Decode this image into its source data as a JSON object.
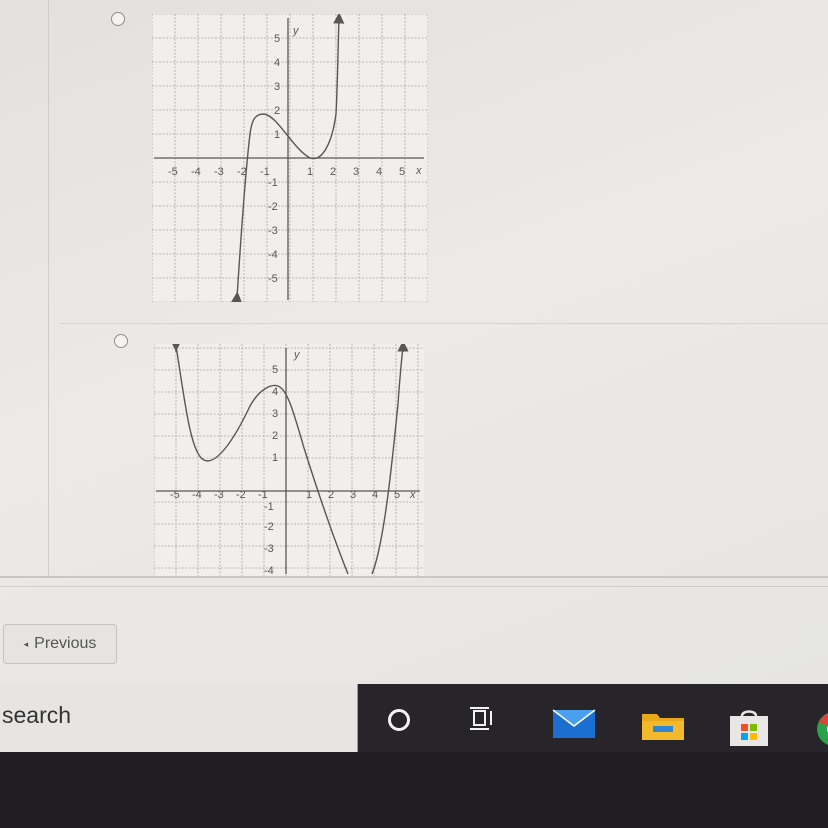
{
  "options": [
    {
      "graph": {
        "x_label": "x",
        "y_label": "y",
        "x_ticks": [
          "-5",
          "-4",
          "-3",
          "-2",
          "-1",
          "1",
          "2",
          "3",
          "4",
          "5"
        ],
        "y_ticks": [
          "5",
          "4",
          "3",
          "2",
          "1",
          "-1",
          "-2",
          "-3",
          "-4",
          "-5"
        ],
        "curve": [
          [
            -2.2,
            -5.7
          ],
          [
            -1.5,
            1.8
          ],
          [
            -1,
            2
          ],
          [
            0,
            1
          ],
          [
            1,
            0
          ],
          [
            1.5,
            1.5
          ],
          [
            2.2,
            5.8
          ]
        ]
      }
    },
    {
      "graph": {
        "x_label": "x",
        "y_label": "y",
        "x_ticks": [
          "-5",
          "-4",
          "-3",
          "-2",
          "-1",
          "1",
          "2",
          "3",
          "4",
          "5"
        ],
        "y_ticks": [
          "5",
          "4",
          "3",
          "2",
          "1",
          "-1",
          "-2",
          "-3",
          "-4"
        ],
        "curve": [
          [
            -5,
            6
          ],
          [
            -4,
            1
          ],
          [
            -3,
            2
          ],
          [
            -2,
            3.6
          ],
          [
            -1,
            4
          ],
          [
            0,
            3.2
          ],
          [
            1,
            0
          ],
          [
            2,
            -2.7
          ],
          [
            3,
            -4.1
          ],
          [
            4,
            -3.1
          ],
          [
            5,
            6
          ]
        ]
      }
    }
  ],
  "navigation": {
    "previous_label": "Previous"
  },
  "taskbar": {
    "search_label": "search",
    "icons": [
      "cortana-circle-icon",
      "task-view-icon",
      "mail-icon",
      "file-explorer-icon",
      "store-icon",
      "chrome-icon"
    ]
  },
  "colors": {
    "curve": "#5a5654",
    "grid": "#a9a7a5",
    "taskbar": "#27242a",
    "mail": "#1a6fd0",
    "folder": "#f2b92c"
  }
}
